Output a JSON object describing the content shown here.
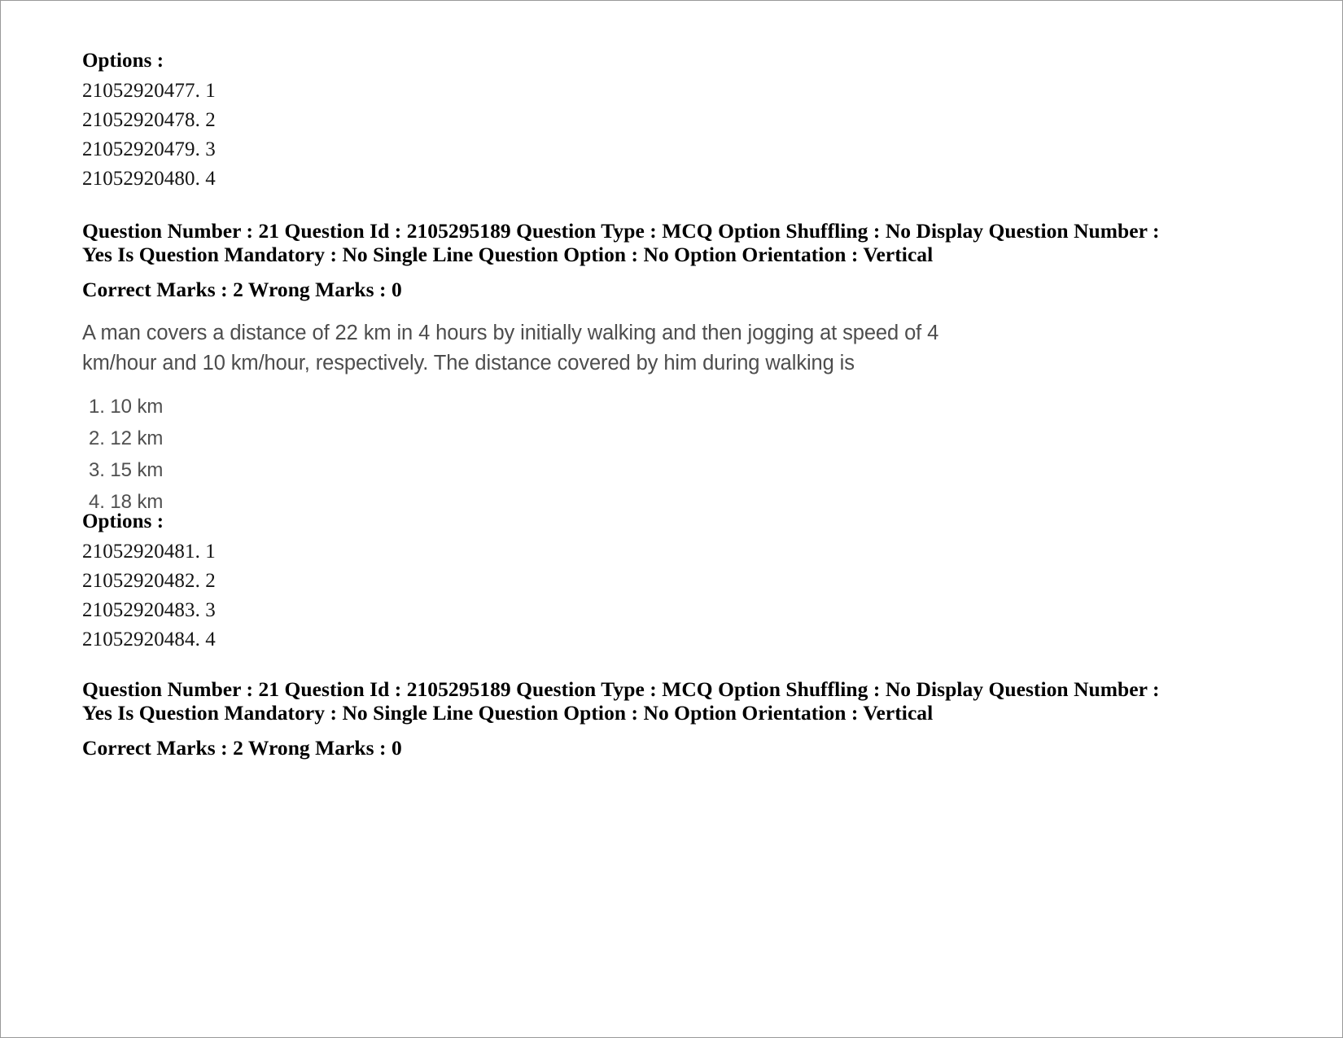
{
  "page": {
    "options_label": "Options :"
  },
  "options_block_1": {
    "label": "Options :",
    "items": [
      "21052920477. 1",
      "21052920478. 2",
      "21052920479. 3",
      "21052920480. 4"
    ]
  },
  "meta_block_1": {
    "line1": "Question Number : 21 Question Id : 2105295189 Question Type : MCQ Option Shuffling : No Display Question Number : Yes Is Question Mandatory : No Single Line Question Option : No Option Orientation : Vertical",
    "marks": "Correct Marks : 2 Wrong Marks : 0"
  },
  "question": {
    "line1": "A man covers a distance of 22 km in 4 hours by initially walking and then jogging at speed of 4",
    "line2": "km/hour and 10 km/hour, respectively. The distance covered by him during walking is",
    "choices": [
      "1. 10 km",
      "2. 12 km",
      "3. 15 km",
      "4. 18 km"
    ]
  },
  "options_block_2": {
    "label": "Options :",
    "items": [
      "21052920481. 1",
      "21052920482. 2",
      "21052920483. 3",
      "21052920484. 4"
    ]
  },
  "meta_block_2": {
    "line1": "Question Number : 21 Question Id : 2105295189 Question Type : MCQ Option Shuffling : No Display Question Number : Yes Is Question Mandatory : No Single Line Question Option : No Option Orientation : Vertical",
    "marks": "Correct Marks : 2 Wrong Marks : 0"
  }
}
